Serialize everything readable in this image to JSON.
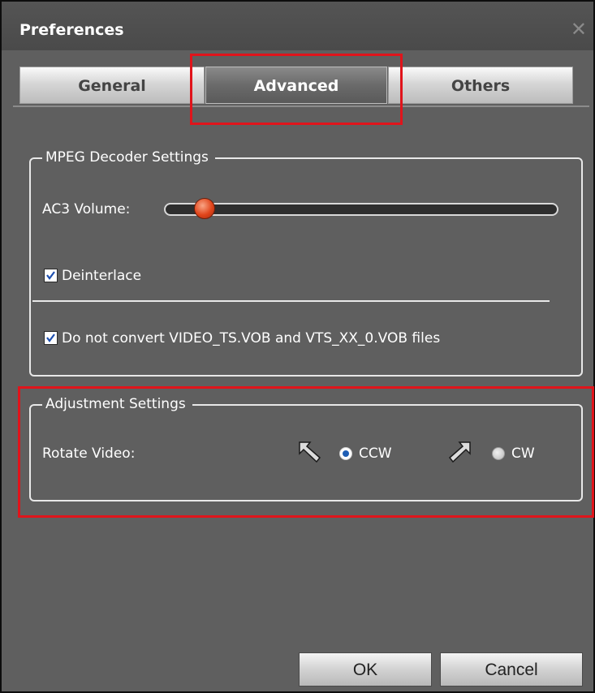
{
  "window": {
    "title": "Preferences",
    "close_icon": "close-icon"
  },
  "tabs": [
    {
      "label": "General",
      "active": false
    },
    {
      "label": "Advanced",
      "active": true
    },
    {
      "label": "Others",
      "active": false
    }
  ],
  "mpeg_group": {
    "legend": "MPEG Decoder Settings",
    "ac3_label": "AC3 Volume:",
    "ac3_volume_fraction": 0.08,
    "deinterlace": {
      "label": "Deinterlace",
      "checked": true
    },
    "do_not_convert": {
      "label": "Do not convert VIDEO_TS.VOB and VTS_XX_0.VOB files",
      "checked": true
    }
  },
  "adjust_group": {
    "legend": "Adjustment Settings",
    "rotate_label": "Rotate Video:",
    "ccw": {
      "label": "CCW",
      "selected": true,
      "icon": "rotate-ccw-arrow-icon"
    },
    "cw": {
      "label": "CW",
      "selected": false,
      "icon": "rotate-cw-arrow-icon"
    }
  },
  "buttons": {
    "ok": "OK",
    "cancel": "Cancel"
  },
  "colors": {
    "highlight": "#e0141b",
    "window_bg": "#5f5f5f",
    "slider_handle": "#e0441a",
    "radio_dot": "#1e5eb5"
  }
}
